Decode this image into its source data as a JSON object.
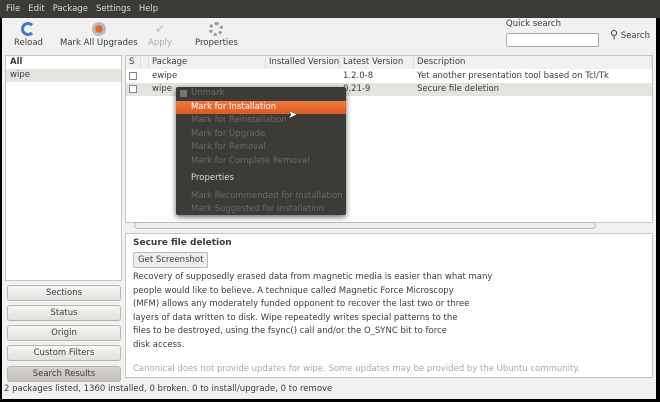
{
  "menubar": [
    "File",
    "Edit",
    "Package",
    "Settings",
    "Help"
  ],
  "toolbar": {
    "reload": "Reload",
    "mark_all": "Mark All Upgrades",
    "apply": "Apply",
    "properties": "Properties",
    "quick_search_label": "Quick search",
    "quick_search_value": "",
    "search": "Search"
  },
  "filters": {
    "items": [
      "All",
      "wipe"
    ],
    "buttons": [
      "Sections",
      "Status",
      "Origin",
      "Custom Filters",
      "Search Results"
    ]
  },
  "table": {
    "headers": [
      "S",
      "",
      "Package",
      "Installed Version",
      "Latest Version",
      "Description"
    ],
    "rows": [
      {
        "package": "ewipe",
        "installed": "",
        "latest": "1.2.0-8",
        "description": "Yet another presentation tool based on Tcl/Tk"
      },
      {
        "package": "wipe",
        "installed": "",
        "latest": "0.21-9",
        "description": "Secure file deletion"
      }
    ]
  },
  "context_menu": [
    "Unmark",
    "Mark for Installation",
    "Mark for Reinstallation",
    "Mark for Upgrade",
    "Mark for Removal",
    "Mark for Complete Removal",
    "Properties",
    "Mark Recommended for Installation",
    "Mark Suggested for Installation"
  ],
  "details": {
    "title": "Secure file deletion",
    "screenshot_btn": "Get Screenshot",
    "lines": [
      "Recovery of supposedly erased data from magnetic media is easier than what many",
      "people would like to believe. A technique called Magnetic Force Microscopy",
      "(MFM) allows any moderately funded opponent to recover the last two or three",
      "layers of data written to disk. Wipe repeatedly writes special patterns to the",
      "files to be destroyed, using the fsync() call and/or the O_SYNC bit to force",
      "disk access."
    ],
    "note": "Canonical does not provide updates for wipe. Some updates may be provided by the Ubuntu community."
  },
  "status": "2 packages listed, 1360 installed, 0 broken. 0 to install/upgrade, 0 to remove"
}
